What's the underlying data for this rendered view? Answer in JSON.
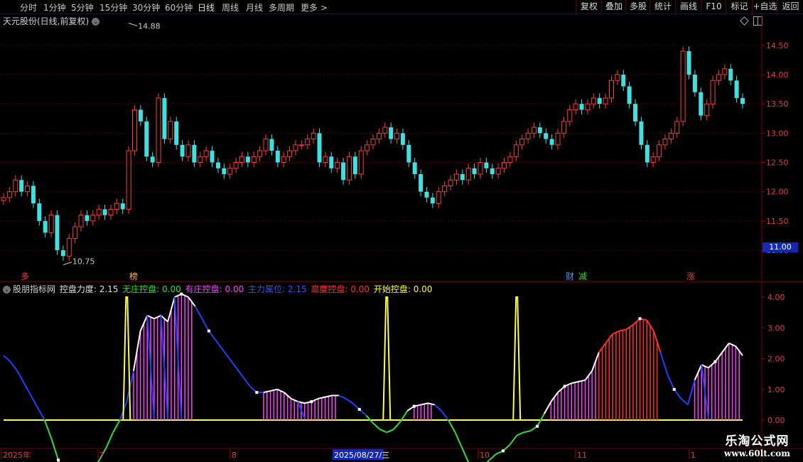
{
  "toolbar": {
    "periods": [
      "分时",
      "1分钟",
      "5分钟",
      "15分钟",
      "30分钟",
      "60分钟",
      "日线",
      "周线",
      "月线",
      "多周期",
      "更多"
    ],
    "active": "日线",
    "right_buttons": [
      "复权",
      "叠加",
      "多股",
      "统计",
      "画线",
      "F10",
      "+自选",
      "返回"
    ],
    "right_marker": "标记"
  },
  "stock": {
    "title": "天元股份(日线,前复权)"
  },
  "price_box": "11.00",
  "markers": {
    "left": "多",
    "bang": "榜",
    "cai": "财",
    "jian": "减",
    "zhang": "涨"
  },
  "indicator": {
    "name": "股朋指标网",
    "fields": [
      {
        "label": "控盘力度:",
        "value": "2.15",
        "color": "#e0e0e0"
      },
      {
        "label": "无庄控盘:",
        "value": "0.00",
        "color": "#30e030"
      },
      {
        "label": "有庄控盘:",
        "value": "0.00",
        "color": "#ff40ff"
      },
      {
        "label": "主力属位:",
        "value": "2.15",
        "color": "#3c50ff"
      },
      {
        "label": "高度控盘:",
        "value": "0.00",
        "color": "#ff3030"
      },
      {
        "label": "开始控盘:",
        "value": "0.00",
        "color": "#ffff30"
      }
    ]
  },
  "date_axis": {
    "labels": [
      "2025年",
      "7",
      "8",
      "2025/08/27/三",
      "10",
      "11",
      "1"
    ]
  },
  "watermark": {
    "line1": "乐淘公式网",
    "line2": "www.60lt.com"
  },
  "chart_data": [
    {
      "type": "candlestick",
      "title": "天元股份(日线,前复权)",
      "ylim": [
        10.6,
        14.85
      ],
      "yticks": [
        "14.50",
        "14.00",
        "13.50",
        "13.00",
        "12.50",
        "12.00",
        "11.50",
        "11.00"
      ],
      "annotations": {
        "high": "14.88",
        "low": "10.75"
      },
      "up_color": "#ff3c3c",
      "down_color": "#40e0e0",
      "closes": [
        11.9,
        12.0,
        12.2,
        12.0,
        12.1,
        11.8,
        11.5,
        11.3,
        11.6,
        11.0,
        10.9,
        11.2,
        11.4,
        11.6,
        11.5,
        11.6,
        11.7,
        11.6,
        11.7,
        11.8,
        11.7,
        12.7,
        13.4,
        13.2,
        12.6,
        12.5,
        13.6,
        12.9,
        13.2,
        12.8,
        12.6,
        12.8,
        12.5,
        12.6,
        12.7,
        12.5,
        12.4,
        12.3,
        12.4,
        12.5,
        12.6,
        12.5,
        12.6,
        12.7,
        12.9,
        12.7,
        12.5,
        12.6,
        12.7,
        12.8,
        12.8,
        12.9,
        13.0,
        12.5,
        12.6,
        12.4,
        12.5,
        12.2,
        12.6,
        12.3,
        12.7,
        12.8,
        12.9,
        13.0,
        13.1,
        12.9,
        13.0,
        12.8,
        12.5,
        12.3,
        12.0,
        11.9,
        11.8,
        12.0,
        12.1,
        12.2,
        12.3,
        12.2,
        12.4,
        12.3,
        12.5,
        12.4,
        12.3,
        12.4,
        12.5,
        12.6,
        12.8,
        12.9,
        13.0,
        13.1,
        13.0,
        12.9,
        12.8,
        13.0,
        13.2,
        13.4,
        13.5,
        13.4,
        13.5,
        13.6,
        13.5,
        13.6,
        13.9,
        14.0,
        13.8,
        13.5,
        13.2,
        12.8,
        12.5,
        12.6,
        12.8,
        12.9,
        13.0,
        13.2,
        14.4,
        14.0,
        13.7,
        13.3,
        13.5,
        13.9,
        14.0,
        14.1,
        13.9,
        13.6,
        13.5
      ],
      "xlabels": [
        "2025年",
        "7",
        "8",
        "2025/08/27/三",
        "10",
        "11",
        "1"
      ]
    },
    {
      "type": "line",
      "title": "股朋指标网",
      "ylim": [
        -0.9,
        4.3
      ],
      "yticks": [
        "4.00",
        "3.00",
        "2.00",
        "1.00",
        "0.00",
        "-1.00"
      ],
      "series": [
        {
          "name": "控盘力度",
          "values": [
            2.1,
            1.9,
            1.6,
            1.2,
            0.8,
            0.4,
            0.0,
            -0.6,
            -1.3,
            -1.9,
            -2.1,
            -2.1,
            -1.9,
            -1.6,
            -1.3,
            -0.9,
            -0.4,
            0.0,
            0.6,
            1.6,
            2.9,
            3.4,
            3.3,
            3.4,
            3.2,
            4.0,
            4.1,
            4.0,
            3.7,
            3.3,
            2.9,
            2.6,
            2.3,
            2.0,
            1.7,
            1.4,
            1.1,
            0.9,
            0.9,
            0.95,
            1.0,
            0.9,
            0.7,
            0.6,
            0.55,
            0.6,
            0.7,
            0.75,
            0.8,
            0.8,
            0.7,
            0.55,
            0.35,
            0.15,
            -0.1,
            -0.3,
            -0.4,
            -0.3,
            -0.05,
            0.3,
            0.45,
            0.5,
            0.55,
            0.5,
            0.3,
            0.0,
            -0.4,
            -0.9,
            -1.4,
            -1.6,
            -1.5,
            -1.3,
            -1.1,
            -1.0,
            -0.8,
            -0.5,
            -0.4,
            -0.35,
            -0.2,
            0.2,
            0.6,
            0.9,
            1.1,
            1.2,
            1.25,
            1.3,
            1.6,
            2.2,
            2.5,
            2.8,
            2.9,
            2.95,
            3.1,
            3.3,
            3.25,
            2.9,
            2.2,
            1.5,
            1.0,
            0.7,
            0.5,
            1.3,
            1.8,
            1.7,
            1.9,
            2.2,
            2.5,
            2.4,
            2.1
          ]
        },
        {
          "name": "开始控盘",
          "values": [
            0,
            0,
            0,
            0,
            0,
            0,
            0,
            0,
            0,
            0,
            0,
            0,
            0,
            0,
            0,
            0,
            0,
            0,
            4,
            0,
            0,
            0,
            0,
            0,
            0,
            0,
            0,
            0,
            0,
            0,
            0,
            0,
            0,
            0,
            0,
            0,
            0,
            0,
            0,
            0,
            0,
            0,
            0,
            0,
            0,
            0,
            0,
            0,
            0,
            0,
            0,
            0,
            0,
            0,
            0,
            0,
            4,
            0,
            0,
            0,
            0,
            0,
            0,
            0,
            0,
            0,
            0,
            0,
            0,
            0,
            0,
            0,
            0,
            0,
            0,
            4,
            0,
            0,
            0,
            0,
            0,
            0,
            0,
            0,
            0,
            0,
            0,
            0,
            0,
            0,
            0,
            0,
            0,
            0,
            0,
            0,
            0,
            0,
            0,
            0,
            0,
            0,
            0,
            0,
            0,
            0,
            0,
            0,
            0
          ]
        },
        {
          "name": "高度控盘",
          "values": [
            0,
            0,
            0,
            0,
            0,
            0,
            0,
            0,
            0,
            0,
            0,
            0,
            0,
            0,
            0,
            0,
            0,
            0,
            0,
            0,
            0,
            0,
            0,
            0,
            0,
            0,
            0,
            0,
            0,
            0,
            0,
            0,
            0,
            0,
            0,
            0,
            0,
            0,
            0,
            0,
            0,
            0,
            0,
            0,
            0,
            0,
            0,
            0,
            0,
            0,
            0,
            0,
            0,
            0,
            0,
            0,
            0,
            0,
            0,
            0,
            0,
            0,
            0,
            0,
            0,
            0,
            0,
            0,
            0,
            0,
            0,
            0,
            0,
            0,
            0,
            0,
            0,
            0,
            0,
            0,
            0,
            0,
            0,
            0,
            0,
            0,
            0,
            0,
            0,
            0,
            0,
            0,
            0,
            0,
            0,
            0,
            0,
            0,
            0,
            0,
            0,
            0,
            0,
            0,
            0,
            0,
            0,
            0,
            0
          ]
        }
      ]
    }
  ]
}
